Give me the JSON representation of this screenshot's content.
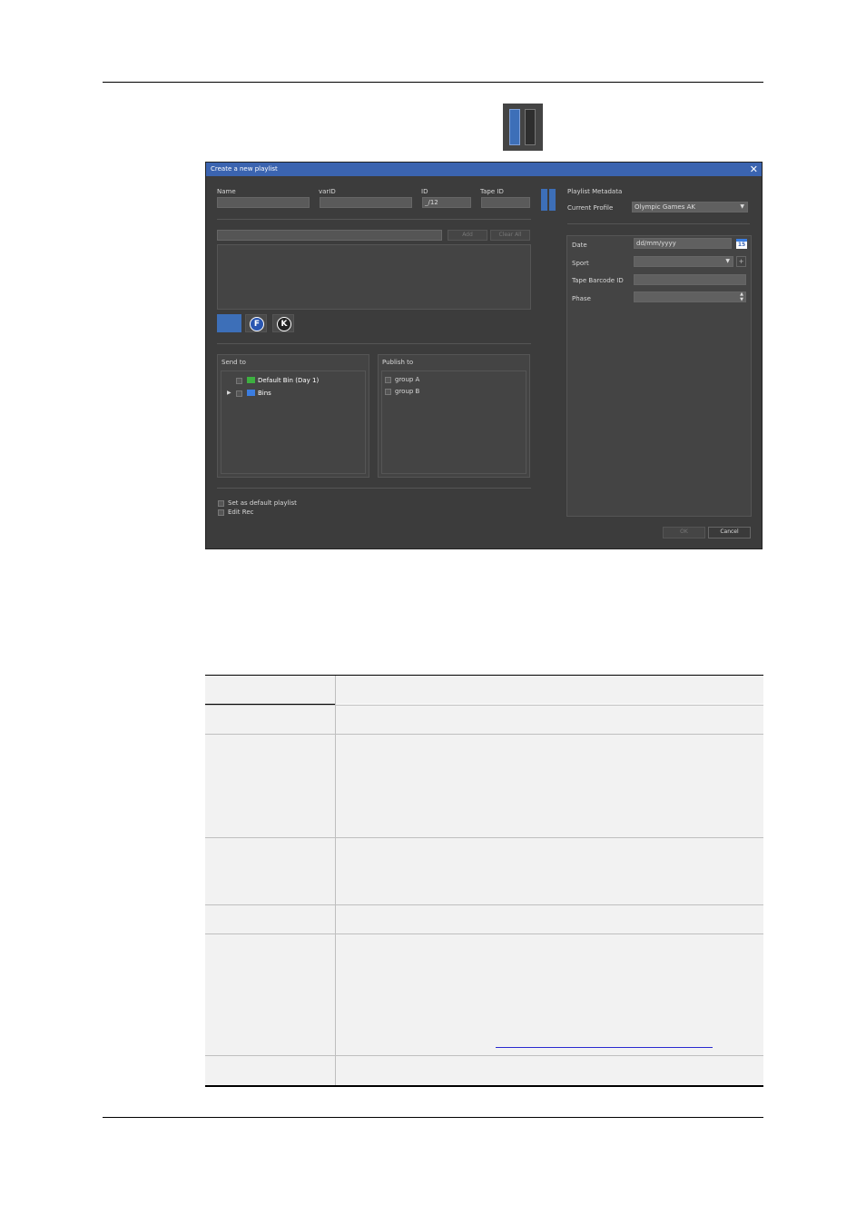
{
  "dialog": {
    "title": "Create a new playlist",
    "close_glyph": "✕",
    "fields": {
      "name_label": "Name",
      "varid_label": "varID",
      "id_label": "ID",
      "id_value": "_/12",
      "tapeid_label": "Tape ID"
    },
    "add_button": "Add",
    "clear_all_button": "Clear All",
    "channel_buttons": [
      "F",
      "K"
    ],
    "send_to": {
      "title": "Send to",
      "items": [
        {
          "label": "Default Bin (Day 1)",
          "icon": "folder-green-icon"
        },
        {
          "label": "Bins",
          "icon": "folder-blue-icon"
        }
      ]
    },
    "publish_to": {
      "title": "Publish to",
      "items": [
        "group A",
        "group B"
      ]
    },
    "options": [
      "Set as default playlist",
      "Edit Rec"
    ],
    "metadata": {
      "title": "Playlist Metadata",
      "profile_label": "Current Profile",
      "profile_value": "Olympic Games AK",
      "date_label": "Date",
      "date_placeholder": "dd/mm/yyyy",
      "calendar_day": "15",
      "sport_label": "Sport",
      "tape_barcode_label": "Tape Barcode ID",
      "phase_label": "Phase"
    },
    "ok_button": "OK",
    "cancel_button": "Cancel"
  }
}
